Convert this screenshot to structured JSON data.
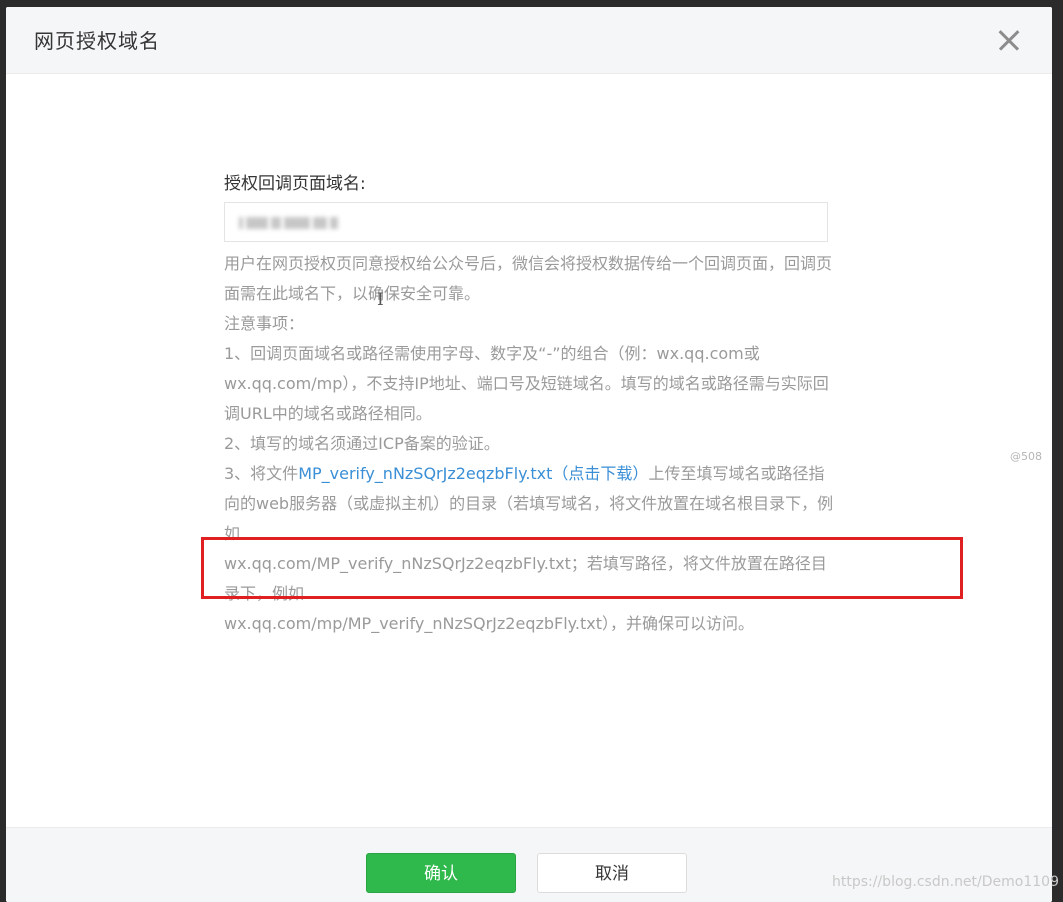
{
  "dialog": {
    "title": "网页授权域名",
    "close_icon": "close-icon"
  },
  "form": {
    "label": "授权回调页面域名:",
    "input_value_obscured": true
  },
  "description": {
    "para1": "用户在网页授权页同意授权给公众号后，微信会将授权数据传给一个回调页面，回调页面需在此域名下，以确保安全可靠。",
    "notes_title": "注意事项：",
    "note1": "1、回调页面域名或路径需使用字母、数字及“-”的组合（例：wx.qq.com或wx.qq.com/mp），不支持IP地址、端口号及短链域名。填写的域名或路径需与实际回调URL中的域名或路径相同。",
    "note2": "2、填写的域名须通过ICP备案的验证。",
    "note3_prefix": "3、将文件",
    "note3_link": "MP_verify_nNzSQrJz2eqzbFly.txt（点击下载）",
    "note3_text": "上传至填写域名或路径指向的web服务器（或虚拟主机）的目录（若填写域名，将文件放置在域名根目录下，例如",
    "note3_example1": "wx.qq.com/MP_verify_nNzSQrJz2eqzbFly.txt；若填写路径，将文件放置在路径目录下，例如",
    "note3_example2": "wx.qq.com/mp/MP_verify_nNzSQrJz2eqzbFly.txt），并确保可以访问。"
  },
  "footer": {
    "confirm_label": "确认",
    "cancel_label": "取消"
  },
  "watermarks": {
    "side": "@508",
    "bottom": "https://blog.csdn.net/Demo1109"
  },
  "colors": {
    "primary": "#2fb84b",
    "link": "#3a8fd6",
    "highlight": "#e02020"
  }
}
